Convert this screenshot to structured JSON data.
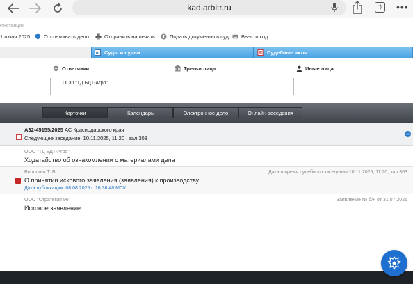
{
  "browser": {
    "url": "kad.arbitr.ru",
    "tabs_count": ":)",
    "more": "•••"
  },
  "breadcrumb": {
    "instances": "Инстанции"
  },
  "toolbar": {
    "date": "1 июля 2025",
    "track_label": "Отслеживать дело",
    "print_label": "Отправить на печать",
    "submit_label": "Подать документы в суд",
    "code_label": "Ввести код"
  },
  "sections": {
    "courts_label": "Суды и судьи",
    "acts_label": "Судебные акты"
  },
  "parties": {
    "respondents_label": "Ответчики",
    "third_parties_label": "Третьи лица",
    "others_label": "Иные лица",
    "respondent_value": "ООО \"ТД БДТ-Агро\""
  },
  "tabs": [
    {
      "label": "Карточки",
      "active": true
    },
    {
      "label": "Календарь",
      "active": false
    },
    {
      "label": "Электронное дело",
      "active": false
    },
    {
      "label": "Онлайн-заседания",
      "active": false
    }
  ],
  "case": {
    "number": "А32-45155/2025",
    "court": "АС Краснодарского края",
    "next_hearing": "Следующее заседание: 10.11.2025, 11:20 , зал 303"
  },
  "entries": [
    {
      "author": "ООО \"ТД БДТ-Агро\"",
      "title": "Ходатайство об ознакомлении с материалами дела",
      "right": "",
      "link": ""
    },
    {
      "author": "Вологина Т. В.",
      "title": "О принятии искового заявления (заявления) к производству",
      "right": "Дата и время судебного заседания 10.11.2025, 11:20, зал 303",
      "link": "Дата публикации: 08.08.2025 г. 16:38:48 МСК"
    },
    {
      "author": "ООО \"Стратегия 96\"",
      "title": "Исковое заявление",
      "right": "Заявление № б/н от 31.07.2025",
      "link": ""
    }
  ],
  "colors": {
    "accent_blue": "#4aa3e2",
    "link_blue": "#2a7ac7",
    "dark_strip": "#40444b",
    "pdf_red": "#c62828"
  }
}
